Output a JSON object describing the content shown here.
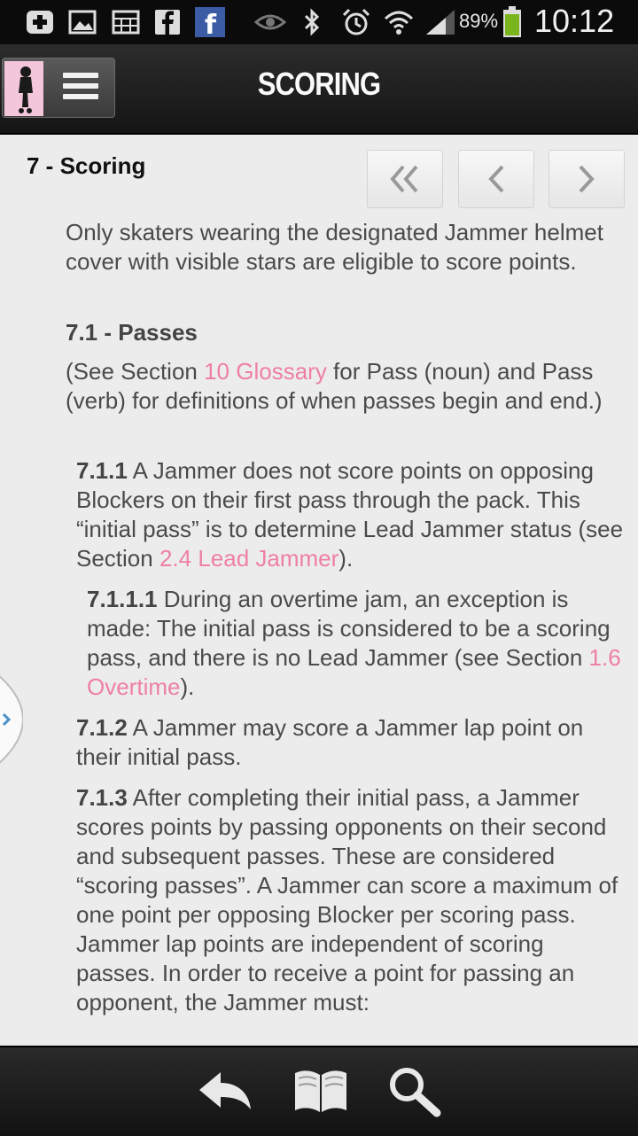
{
  "status_bar": {
    "icons": [
      "add-icon",
      "image-icon",
      "calendar-icon",
      "facebook-icon",
      "facebook-app-icon",
      "eye-icon",
      "bluetooth-icon",
      "alarm-icon",
      "wifi-icon",
      "signal-icon"
    ],
    "battery_pct": "89%",
    "time": "10:12",
    "battery_color": "#7ab51d"
  },
  "action_bar": {
    "title": "SCORING"
  },
  "content": {
    "section_heading": "7 - Scoring",
    "nav_buttons": [
      "first-chevron",
      "previous-chevron",
      "next-chevron"
    ],
    "intro": "Only skaters wearing the designated Jammer helmet cover with visible stars are eligible to score points.",
    "sub_heading": "7.1 - Passes",
    "see_section": {
      "before": "(See Section ",
      "link": "10 Glossary",
      "after": " for Pass (noun) and Pass (verb) for definitions of when passes begin and end.)"
    },
    "r711": {
      "num": "7.1.1",
      "before": " A Jammer does not score points on opposing Blockers on their first pass through the pack. This “initial pass” is to determine Lead Jammer status (see Section ",
      "link": "2.4 Lead Jammer",
      "after": ")."
    },
    "r7111": {
      "num": "7.1.1.1",
      "before": " During an overtime jam, an exception is made: The initial pass is considered to be a scoring pass, and there is no Lead Jammer (see Section ",
      "link": "1.6 Overtime",
      "after": ")."
    },
    "r712": {
      "num": "7.1.2",
      "text": " A Jammer may score a Jammer lap point on their initial pass."
    },
    "r713": {
      "num": "7.1.3",
      "text": " After completing their initial pass, a Jammer scores points by passing opponents on their second and subsequent passes. These are considered “scoring passes”. A Jammer can score a maximum of one point per opposing Blocker per scoring pass. Jammer lap points are independent of scoring passes. In order to receive a point for passing an opponent, the Jammer must:"
    },
    "link_color": "#ee7fa6"
  },
  "bottom_bar": {
    "buttons": [
      "back-icon",
      "book-icon",
      "search-icon"
    ]
  }
}
